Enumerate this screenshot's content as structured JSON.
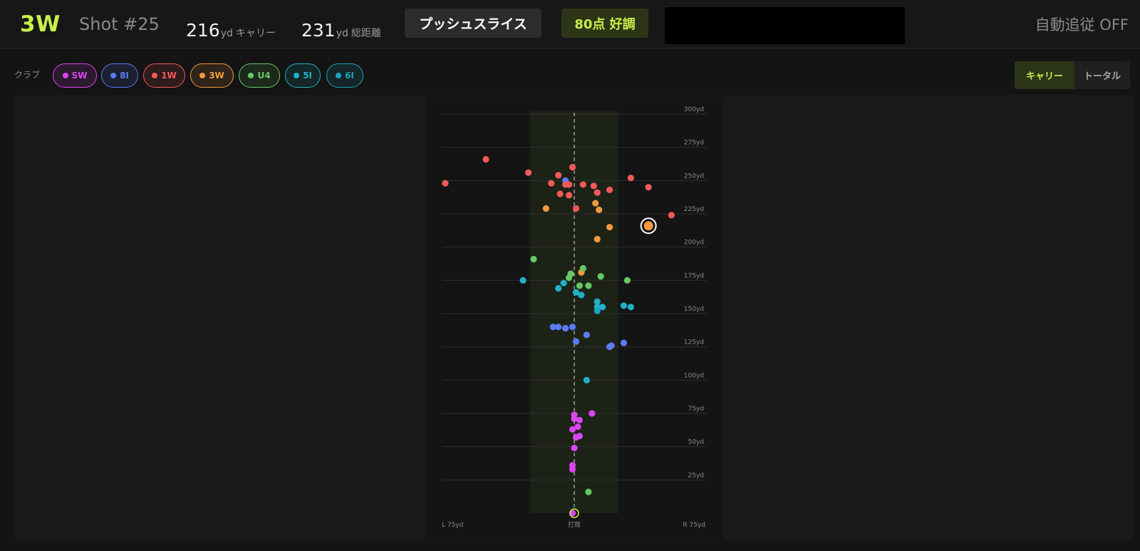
{
  "header": {
    "club": "3W",
    "shot": "Shot #25",
    "carry_value": "216",
    "carry_unit": "yd",
    "carry_label": "キャリー",
    "total_value": "231",
    "total_unit": "yd",
    "total_label": "総距離",
    "shot_shape": "プッシュスライス",
    "score": "80点 好調",
    "auto_follow": "自動追従 OFF"
  },
  "filter": {
    "label": "クラブ",
    "clubs": [
      {
        "name": "SW",
        "color": "#d946ef"
      },
      {
        "name": "8I",
        "color": "#5b7cf5"
      },
      {
        "name": "1W",
        "color": "#f25a5a"
      },
      {
        "name": "3W",
        "color": "#f5993e"
      },
      {
        "name": "U4",
        "color": "#66c964"
      },
      {
        "name": "5I",
        "color": "#22b0c9"
      },
      {
        "name": "6I",
        "color": "#1ea2bf"
      }
    ]
  },
  "view_toggle": {
    "carry": "キャリー",
    "total": "トータル",
    "active": "carry"
  },
  "chart_data": {
    "type": "scatter",
    "x_unit": "yd (lateral, negative = left)",
    "y_unit": "yd (carry)",
    "xlim": [
      -75,
      75
    ],
    "ylim": [
      0,
      300
    ],
    "y_ticks": [
      {
        "value": 25,
        "label": "25yd"
      },
      {
        "value": 50,
        "label": "50yd"
      },
      {
        "value": 75,
        "label": "75yd"
      },
      {
        "value": 100,
        "label": "100yd"
      },
      {
        "value": 125,
        "label": "125yd"
      },
      {
        "value": 150,
        "label": "150yd"
      },
      {
        "value": 175,
        "label": "175yd"
      },
      {
        "value": 200,
        "label": "200yd"
      },
      {
        "value": 225,
        "label": "225yd"
      },
      {
        "value": 250,
        "label": "250yd"
      },
      {
        "value": 275,
        "label": "275yd"
      },
      {
        "value": 300,
        "label": "300yd"
      }
    ],
    "x_left_label": "L 75yd",
    "x_center_label": "打席",
    "x_right_label": "R 75yd",
    "fairway_half_width_yd": 25,
    "selected": {
      "club": "3W",
      "x": 42,
      "y": 216
    },
    "series": [
      {
        "name": "SW",
        "color": "#d946ef",
        "points": [
          [
            -5,
            139
          ],
          [
            0,
            74
          ],
          [
            0,
            71
          ],
          [
            3,
            70
          ],
          [
            10,
            75
          ],
          [
            -1,
            63
          ],
          [
            2,
            65
          ],
          [
            3,
            58
          ],
          [
            1,
            57
          ],
          [
            0,
            49
          ],
          [
            -1,
            36
          ],
          [
            -1,
            33
          ],
          [
            -1,
            0
          ]
        ]
      },
      {
        "name": "8I",
        "color": "#5b7cf5",
        "points": [
          [
            -12,
            140
          ],
          [
            -9,
            140
          ],
          [
            -5,
            139
          ],
          [
            -1,
            140
          ],
          [
            7,
            134
          ],
          [
            1,
            129
          ],
          [
            20,
            125
          ],
          [
            21,
            126
          ],
          [
            28,
            128
          ],
          [
            -5,
            250
          ]
        ]
      },
      {
        "name": "1W",
        "color": "#f25a5a",
        "points": [
          [
            -50,
            266
          ],
          [
            -26,
            256
          ],
          [
            -9,
            254
          ],
          [
            -1,
            260
          ],
          [
            -73,
            248
          ],
          [
            -13,
            248
          ],
          [
            -5,
            247
          ],
          [
            -3,
            247
          ],
          [
            5,
            247
          ],
          [
            11,
            246
          ],
          [
            32,
            252
          ],
          [
            42,
            245
          ],
          [
            20,
            243
          ],
          [
            13,
            241
          ],
          [
            -8,
            240
          ],
          [
            -3,
            239
          ],
          [
            1,
            229
          ],
          [
            55,
            224
          ]
        ]
      },
      {
        "name": "3W",
        "color": "#f5993e",
        "points": [
          [
            -16,
            229
          ],
          [
            12,
            233
          ],
          [
            14,
            228
          ],
          [
            20,
            215
          ],
          [
            13,
            206
          ],
          [
            4,
            181
          ]
        ]
      },
      {
        "name": "U4",
        "color": "#66c964",
        "points": [
          [
            -23,
            191
          ],
          [
            5,
            184
          ],
          [
            -2,
            180
          ],
          [
            -3,
            177
          ],
          [
            15,
            178
          ],
          [
            30,
            175
          ],
          [
            3,
            171
          ],
          [
            8,
            171
          ],
          [
            8,
            16
          ]
        ]
      },
      {
        "name": "5I",
        "color": "#22b0c9",
        "points": [
          [
            -29,
            175
          ],
          [
            -6,
            173
          ],
          [
            -9,
            169
          ],
          [
            1,
            166
          ],
          [
            4,
            164
          ],
          [
            13,
            159
          ],
          [
            13,
            155
          ],
          [
            16,
            155
          ],
          [
            28,
            156
          ],
          [
            32,
            155
          ],
          [
            7,
            100
          ]
        ]
      },
      {
        "name": "6I",
        "color": "#1ea2bf",
        "points": [
          [
            13,
            152
          ]
        ]
      }
    ]
  }
}
